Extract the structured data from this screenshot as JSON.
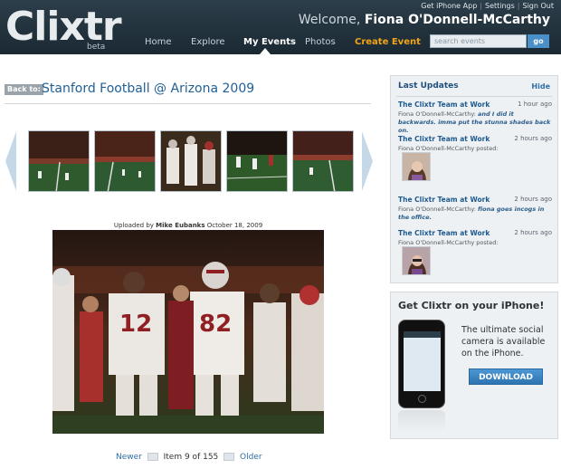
{
  "header": {
    "logo": "Clixtr",
    "beta": "beta",
    "top_links": [
      "Get iPhone App",
      "Settings",
      "Sign Out"
    ],
    "welcome_prefix": "Welcome,",
    "user_name": "Fiona O'Donnell-McCarthy",
    "nav": [
      {
        "label": "Home"
      },
      {
        "label": "Explore"
      },
      {
        "label": "My Events"
      },
      {
        "label": "Photos"
      },
      {
        "label": "Create Event"
      }
    ],
    "search_placeholder": "search events",
    "go_label": "go"
  },
  "event": {
    "back_label": "Back to:",
    "title": "Stanford Football @ Arizona 2009"
  },
  "photo": {
    "uploaded_prefix": "Uploaded by",
    "uploader": "Mike Eubanks",
    "date": "October 18, 2009"
  },
  "pager": {
    "newer": "Newer",
    "item_text": "Item 9 of 155",
    "older": "Older"
  },
  "updates": {
    "title": "Last Updates",
    "hide": "Hide",
    "items": [
      {
        "title": "The Clixtr Team at Work",
        "time": "1 hour ago",
        "author": "Fiona O'Donnell-McCarthy:",
        "message": "and I did it backwards. imma put the stunna shades back on."
      },
      {
        "title": "The Clixtr Team at Work",
        "time": "2 hours ago",
        "author": "Fiona O'Donnell-McCarthy posted:",
        "message": ""
      },
      {
        "title": "The Clixtr Team at Work",
        "time": "2 hours ago",
        "author": "Fiona O'Donnell-McCarthy:",
        "message": "fiona goes incogs in the office."
      },
      {
        "title": "The Clixtr Team at Work",
        "time": "2 hours ago",
        "author": "Fiona O'Donnell-McCarthy posted:",
        "message": ""
      }
    ]
  },
  "promo": {
    "title": "Get Clixtr on your iPhone!",
    "text": "The ultimate social camera is available on the iPhone.",
    "button": "DOWNLOAD"
  },
  "colors": {
    "header_bg": "#1b2933",
    "accent_blue": "#1f5f96",
    "create_event": "#f2a516",
    "download_button": "#2d74b1"
  }
}
